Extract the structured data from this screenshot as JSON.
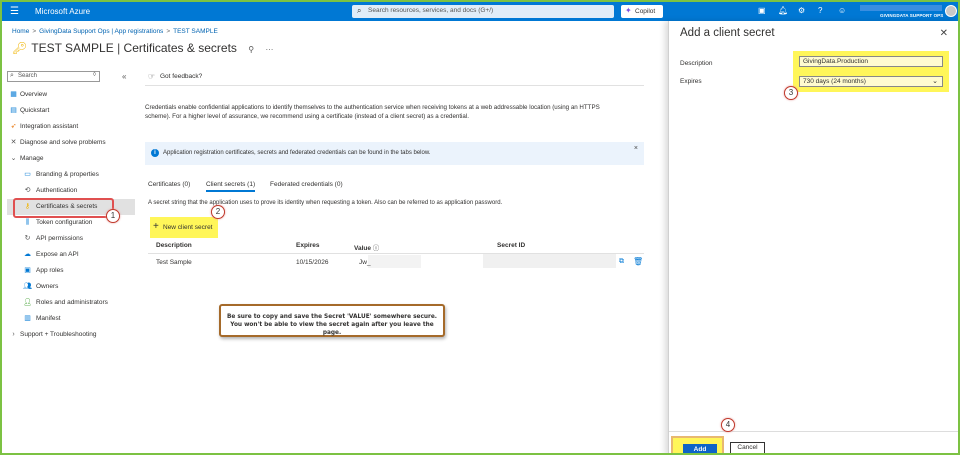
{
  "topbar": {
    "brand": "Microsoft Azure",
    "search_placeholder": "Search resources, services, and docs (G+/)",
    "copilot_label": "Copilot",
    "account_org": "GIVINGDATA SUPPORT OPS",
    "bg_color": "#0078d4"
  },
  "breadcrumb": [
    "Home",
    "GivingData Support Ops | App registrations",
    "TEST SAMPLE"
  ],
  "page": {
    "app_name": "TEST SAMPLE",
    "divider": "|",
    "section": "Certificates & secrets"
  },
  "sidebar": {
    "search_placeholder": "Search",
    "items": [
      {
        "label": "Overview",
        "icon": "grid-icon"
      },
      {
        "label": "Quickstart",
        "icon": "quickstart-icon"
      },
      {
        "label": "Integration assistant",
        "icon": "rocket-icon"
      },
      {
        "label": "Diagnose and solve problems",
        "icon": "wrench-icon"
      },
      {
        "label": "Manage",
        "icon": "chevron-down-icon"
      },
      {
        "label": "Branding & properties",
        "icon": "branding-icon"
      },
      {
        "label": "Authentication",
        "icon": "auth-icon"
      },
      {
        "label": "Certificates & secrets",
        "icon": "key-icon"
      },
      {
        "label": "Token configuration",
        "icon": "token-icon"
      },
      {
        "label": "API permissions",
        "icon": "permissions-icon"
      },
      {
        "label": "Expose an API",
        "icon": "cloud-icon"
      },
      {
        "label": "App roles",
        "icon": "roles-icon"
      },
      {
        "label": "Owners",
        "icon": "owners-icon"
      },
      {
        "label": "Roles and administrators",
        "icon": "admin-icon"
      },
      {
        "label": "Manifest",
        "icon": "manifest-icon"
      },
      {
        "label": "Support + Troubleshooting",
        "icon": "chevron-right-icon"
      }
    ]
  },
  "main": {
    "feedback": "Got feedback?",
    "intro": "Credentials enable confidential applications to identify themselves to the authentication service when receiving tokens at a web addressable location (using an HTTPS scheme). For a higher level of assurance, we recommend using a certificate (instead of a client secret) as a credential.",
    "info": "Application registration certificates, secrets and federated credentials can be found in the tabs below.",
    "tabs": [
      "Certificates (0)",
      "Client secrets (1)",
      "Federated credentials (0)"
    ],
    "tab_description": "A secret string that the application uses to prove its identity when requesting a token. Also can be referred to as application password.",
    "new_secret_label": "New client secret",
    "columns": [
      "Description",
      "Expires",
      "Value",
      "Secret ID"
    ],
    "rows": [
      {
        "description": "Test Sample",
        "expires": "10/15/2026",
        "value": "Jw_"
      }
    ],
    "note_line1": "Be sure to copy and save the Secret 'VALUE' somewhere secure.",
    "note_line2": "You won't be able to view the secret again after you leave the page."
  },
  "panel": {
    "title": "Add a client secret",
    "description_label": "Description",
    "description_value": "GivingData.Production",
    "expires_label": "Expires",
    "expires_value": "730 days (24 months)",
    "add_label": "Add",
    "cancel_label": "Cancel"
  },
  "callouts": [
    "1",
    "2",
    "3",
    "4"
  ],
  "colors": {
    "highlight": "#fff659",
    "callout_ring": "#c0392b",
    "accent": "#0078d4"
  }
}
